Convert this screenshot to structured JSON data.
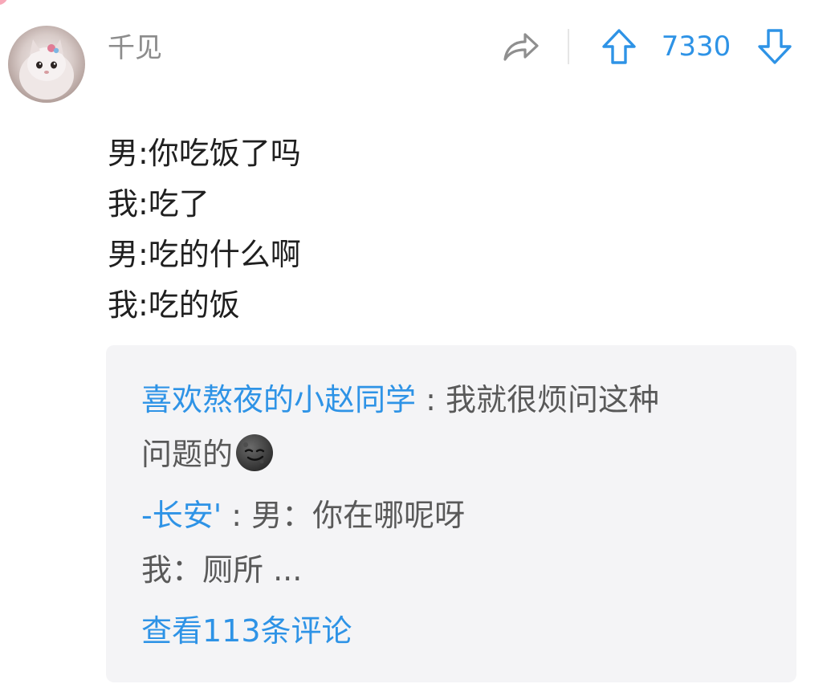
{
  "comment": {
    "username": "千见",
    "vote_count": "7330",
    "body_lines": [
      "男:你吃饭了吗",
      "我:吃了",
      "男:吃的什么啊",
      "我:吃的饭"
    ]
  },
  "replies": [
    {
      "author": "喜欢熬夜的小赵同学",
      "separator": " : ",
      "line1": "我就很烦问这种",
      "line2": "问题的"
    },
    {
      "author": "-长安'",
      "separator": " : ",
      "line1": "男：你在哪呢呀",
      "line2": "我：厕所 ..."
    }
  ],
  "view_more_label": "查看113条评论",
  "icons": {
    "share": "share-icon",
    "upvote": "upvote-arrow-icon",
    "downvote": "downvote-arrow-icon",
    "emoji": "smirking-moon-emoji"
  },
  "colors": {
    "accent": "#2e93e6",
    "username": "#8c8c8c",
    "body_text": "#1f1f1f",
    "reply_text": "#595959",
    "reply_background": "#f4f4f6"
  }
}
